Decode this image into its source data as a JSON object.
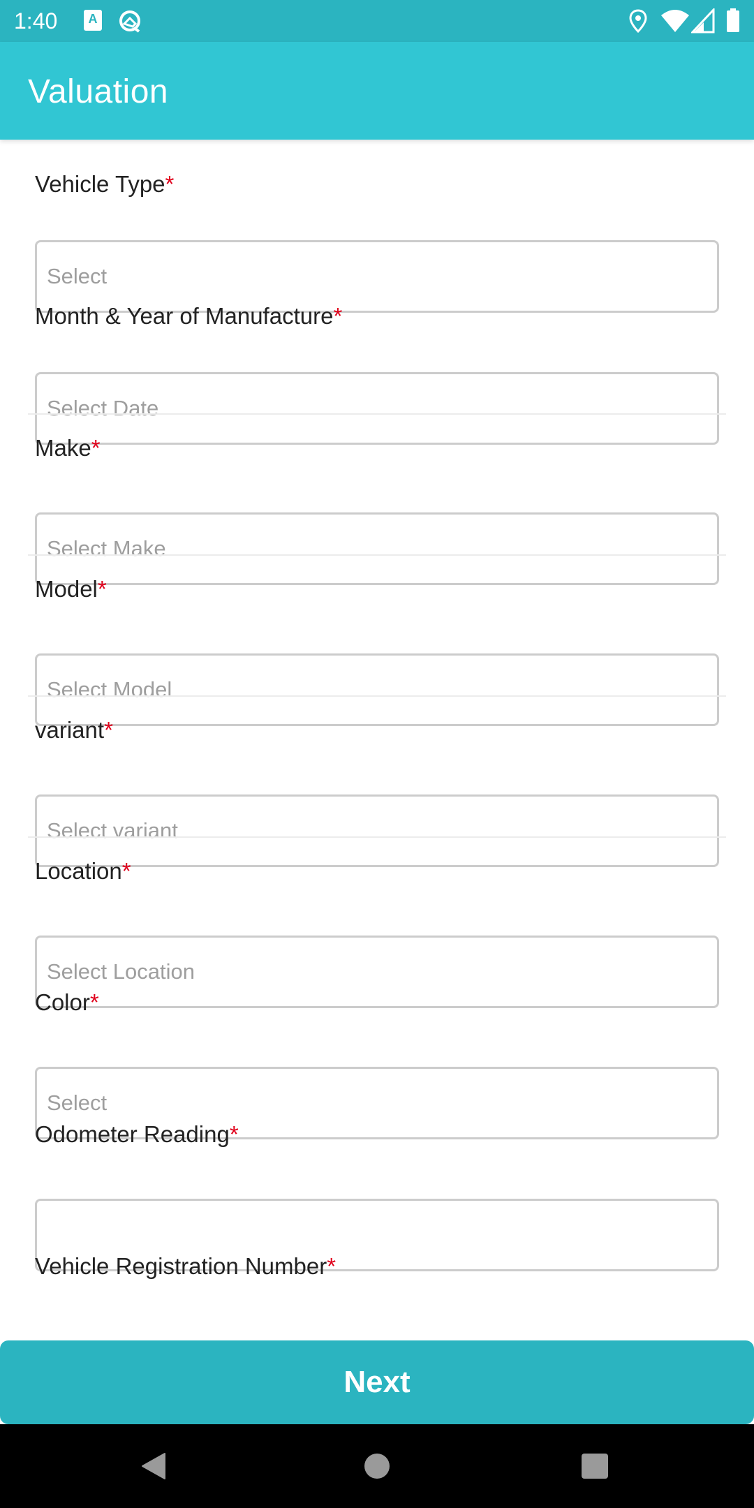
{
  "status_bar": {
    "time": "1:40",
    "left_icons": [
      "accessibility-a-icon",
      "android-q-icon"
    ],
    "right_icons": [
      "location-icon",
      "wifi-icon",
      "cellular-signal-icon",
      "battery-icon"
    ]
  },
  "app_bar": {
    "title": "Valuation"
  },
  "form": {
    "required_marker": "*",
    "fields": [
      {
        "label": "Vehicle Type",
        "placeholder": "Select",
        "value": ""
      },
      {
        "label": "Month & Year of Manufacture",
        "placeholder": "Select Date",
        "value": ""
      },
      {
        "label": "Make",
        "placeholder": "Select Make",
        "value": ""
      },
      {
        "label": "Model",
        "placeholder": "Select Model",
        "value": ""
      },
      {
        "label": "variant",
        "placeholder": "Select variant",
        "value": ""
      },
      {
        "label": "Location",
        "placeholder": "Select Location",
        "value": ""
      },
      {
        "label": "Color",
        "placeholder": "Select",
        "value": ""
      },
      {
        "label": "Odometer Reading",
        "placeholder": "",
        "value": ""
      },
      {
        "label": "Vehicle Registration Number",
        "placeholder": "",
        "value": ""
      }
    ]
  },
  "actions": {
    "next_label": "Next"
  },
  "colors": {
    "status_bar": "#2bb4c0",
    "app_bar": "#31c6d3",
    "button": "#2bb4c0",
    "required": "#e0001b"
  },
  "nav_bar": {
    "buttons": [
      "back-icon",
      "home-icon",
      "recents-icon"
    ]
  }
}
